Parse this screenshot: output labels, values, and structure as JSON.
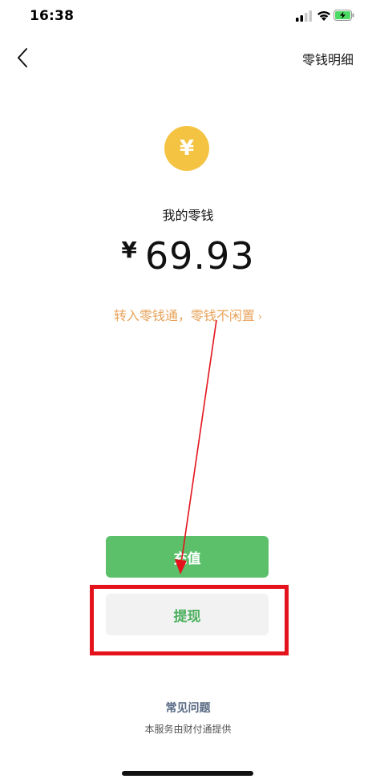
{
  "status_bar": {
    "time": "16:38"
  },
  "nav": {
    "back_icon": "chevron-left-icon",
    "detail_link": "零钱明细"
  },
  "balance": {
    "coin_icon": "yen-coin-icon",
    "coin_symbol": "¥",
    "title": "我的零钱",
    "currency": "¥",
    "amount": "69.93",
    "promo_text": "转入零钱通，零钱不闲置",
    "promo_chevron": "›"
  },
  "actions": {
    "topup_label": "充值",
    "withdraw_label": "提现"
  },
  "footer": {
    "faq_label": "常见问题",
    "provider_note": "本服务由财付通提供"
  },
  "colors": {
    "coin": "#f5c342",
    "primary_green": "#5cc06b",
    "promo_orange": "#e8a35a",
    "annotation_red": "#e3121b",
    "faq_blue_gray": "#566883"
  }
}
